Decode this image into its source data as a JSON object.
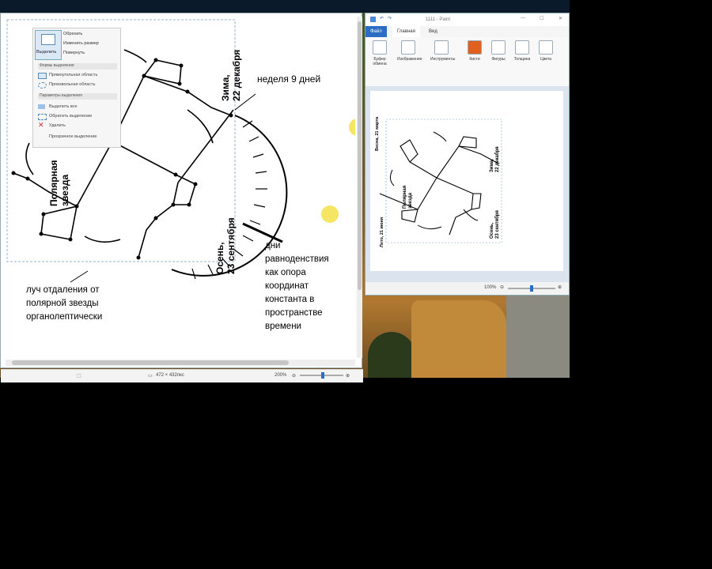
{
  "select_menu": {
    "tool_label": "Выделить",
    "side_buttons": [
      "Обрезать",
      "Изменить размер",
      "Повернуть"
    ],
    "section_shapes": "Формы выделения",
    "shape_items": [
      "Прямоугольная область",
      "Произвольная область"
    ],
    "section_params": "Параметры выделения",
    "param_items": [
      "Выделить все",
      "Обратить выделение",
      "Удалить",
      "Прозрачное выделение"
    ]
  },
  "drawing": {
    "winter": "Зима,\n22 декабря",
    "autumn": "Осень,\n23 сентября",
    "polar_star": "Полярная\nзвезда",
    "spring_small": "Весна, 21 марта",
    "summer_small": "Лето, 21 июня"
  },
  "annotations": {
    "week": "неделя  9 дней",
    "equinox": [
      "дни",
      "равноденствия",
      "как опора",
      "координат",
      "константа в",
      "пространстве",
      "времени"
    ],
    "ray": [
      "луч отдаления от",
      "полярной звезды",
      "органолептически"
    ]
  },
  "big_status": {
    "size": "472 × 432пкс",
    "zoom": "200%"
  },
  "small_window": {
    "title": "1111 - Paint",
    "tabs": [
      "Файл",
      "Главная",
      "Вид"
    ],
    "ribbon": [
      "Буфер обмена",
      "Изображение",
      "Инструменты",
      "Кисти",
      "Фигуры",
      "Толщина",
      "Цвета"
    ],
    "zoom": "100%"
  }
}
